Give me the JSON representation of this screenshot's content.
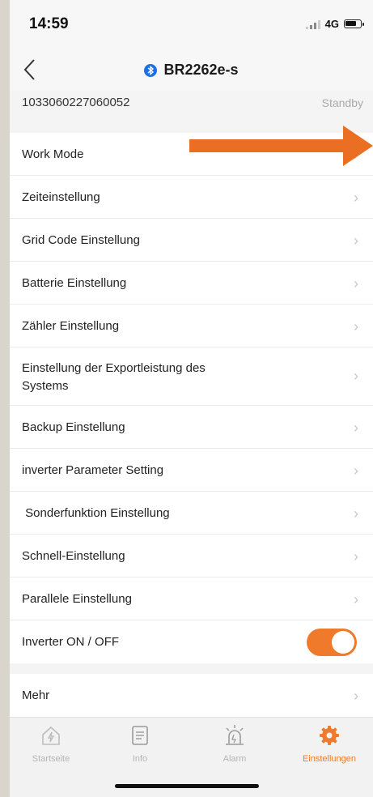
{
  "status_bar": {
    "time": "14:59",
    "network": "4G"
  },
  "nav": {
    "title": "BR2262e-s"
  },
  "device": {
    "serial": "1033060227060052",
    "status": "Standby"
  },
  "settings": {
    "items": [
      {
        "label": "Work Mode"
      },
      {
        "label": "Zeiteinstellung"
      },
      {
        "label": "Grid Code Einstellung"
      },
      {
        "label": "Batterie Einstellung"
      },
      {
        "label": "Zähler Einstellung"
      },
      {
        "label": "Einstellung der Exportleistung des Systems"
      },
      {
        "label": "Backup Einstellung"
      },
      {
        "label": "inverter Parameter Setting"
      },
      {
        "label": " Sonderfunktion Einstellung"
      },
      {
        "label": "Schnell-Einstellung"
      },
      {
        "label": "Parallele Einstellung"
      }
    ],
    "inverter_toggle": {
      "label": "Inverter ON / OFF",
      "on": true
    },
    "more": {
      "label": "Mehr"
    }
  },
  "tabs": [
    {
      "label": "Startseite",
      "icon": "home-bolt-icon"
    },
    {
      "label": "Info",
      "icon": "document-icon"
    },
    {
      "label": "Alarm",
      "icon": "alarm-icon"
    },
    {
      "label": "Einstellungen",
      "icon": "gear-icon",
      "active": true
    }
  ],
  "colors": {
    "accent": "#f07a2c",
    "bluetooth": "#1e6fe0"
  }
}
